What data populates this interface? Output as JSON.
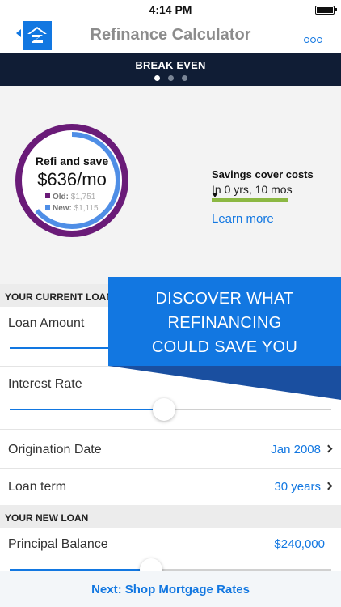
{
  "status_bar": {
    "time": "4:14 PM"
  },
  "nav": {
    "title": "Refinance Calculator"
  },
  "tabs": {
    "label": "BREAK EVEN",
    "page_count": 3,
    "active_index": 0
  },
  "summary": {
    "headline": "Refi and save",
    "amount": "$636/mo",
    "old_label": "Old:",
    "old_value": "$1,751",
    "new_label": "New:",
    "new_value": "$1,115",
    "savings_heading": "Savings cover costs",
    "savings_time": "In 0 yrs, 10 mos",
    "learn_more": "Learn more"
  },
  "current_loan": {
    "section_title": "YOUR CURRENT LOAN",
    "loan_amount_label": "Loan Amount",
    "loan_amount_slider_fraction": 0.35,
    "interest_rate_label": "Interest Rate",
    "interest_rate_slider_fraction": 0.48,
    "origination_label": "Origination Date",
    "origination_value": "Jan 2008",
    "loan_term_label": "Loan term",
    "loan_term_value": "30 years"
  },
  "new_loan": {
    "section_title": "YOUR NEW LOAN",
    "principal_label": "Principal Balance",
    "principal_value": "$240,000",
    "principal_slider_fraction": 0.44
  },
  "promo": {
    "line1": "DISCOVER WHAT",
    "line2": "REFINANCING",
    "line3": "COULD SAVE YOU"
  },
  "footer": {
    "next_label": "Next: Shop Mortgage Rates"
  },
  "colors": {
    "accent": "#1277e1",
    "header_dark": "#101d35",
    "ring_old": "#6a1b78",
    "ring_new": "#4f8ee6",
    "progress_green": "#8cb843",
    "promo_blue": "#1277e1",
    "promo_dark": "#1a4fa0"
  },
  "icons": [
    "back-chevron-icon",
    "zillow-logo-icon",
    "more-options-icon",
    "chevron-right-icon"
  ]
}
